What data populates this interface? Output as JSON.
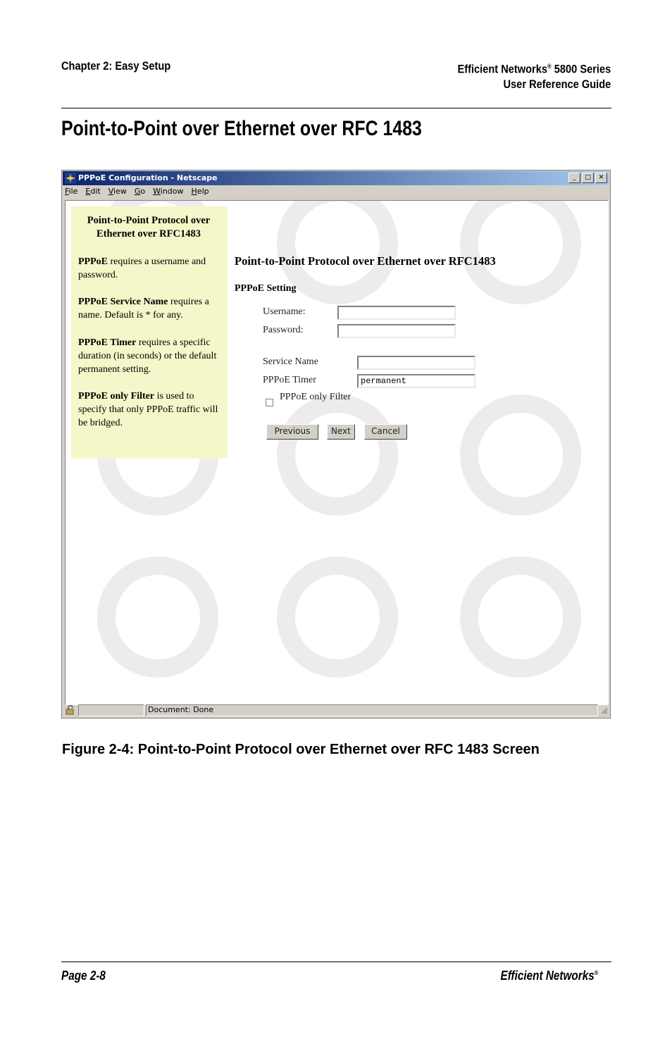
{
  "header": {
    "chapter": "Chapter 2: Easy Setup",
    "brand": "Efficient Networks",
    "reg": "®",
    "series": " 5800 Series",
    "guide": "User Reference Guide"
  },
  "page_title": "Point-to-Point over Ethernet over RFC 1483",
  "browser": {
    "title": "PPPoE Configuration - Netscape",
    "menu": [
      "File",
      "Edit",
      "View",
      "Go",
      "Window",
      "Help"
    ],
    "status": "Document: Done"
  },
  "sidebar": {
    "title": "Point-to-Point Protocol over Ethernet over RFC1483",
    "p1_bold": "PPPoE",
    "p1_text": " requires a username and password.",
    "p2_bold": "PPPoE Service Name",
    "p2_text": " requires a name. Default is * for any.",
    "p3_bold": "PPPoE Timer",
    "p3_text": " requires a specific duration (in seconds) or the default permanent setting.",
    "p4_bold": "PPPoE only Filter",
    "p4_text": " is used to specify that only PPPoE traffic will be bridged."
  },
  "form": {
    "heading": "Point-to-Point Protocol over Ethernet over RFC1483",
    "subheading": "PPPoE Setting",
    "username_label": "Username:",
    "username_value": "",
    "password_label": "Password:",
    "password_value": "",
    "service_label": "Service Name",
    "service_value": "",
    "timer_label": "PPPoE Timer",
    "timer_value": "permanent",
    "filter_label": "PPPoE only Filter",
    "filter_checked": false,
    "previous": "Previous",
    "next": "Next",
    "cancel": "Cancel"
  },
  "caption": "Figure 2-4:  Point-to-Point Protocol over Ethernet over RFC 1483 Screen",
  "footer": {
    "page": "Page 2-8",
    "brand": "Efficient Networks",
    "reg": "®"
  }
}
